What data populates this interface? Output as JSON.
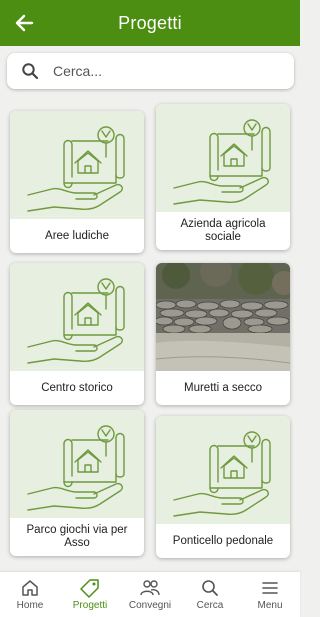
{
  "header": {
    "title": "Progetti",
    "back_icon": "arrow-left-icon"
  },
  "search": {
    "placeholder": "Cerca...",
    "value": "",
    "icon": "search-icon"
  },
  "cards": [
    {
      "label": "Aree ludiche",
      "image": "project-plan-icon"
    },
    {
      "label": "Azienda agricola sociale",
      "image": "project-plan-icon"
    },
    {
      "label": "Centro storico",
      "image": "project-plan-icon"
    },
    {
      "label": "Muretti a secco",
      "image": "stone-wall-photo"
    },
    {
      "label": "Parco giochi via per Asso",
      "image": "project-plan-icon"
    },
    {
      "label": "Ponticello pedonale",
      "image": "project-plan-icon"
    }
  ],
  "nav": {
    "items": [
      {
        "label": "Home",
        "icon": "home-icon",
        "active": false
      },
      {
        "label": "Progetti",
        "icon": "tag-icon",
        "active": true
      },
      {
        "label": "Convegni",
        "icon": "people-icon",
        "active": false
      },
      {
        "label": "Cerca",
        "icon": "search-icon",
        "active": false
      },
      {
        "label": "Menu",
        "icon": "menu-icon",
        "active": false
      }
    ]
  },
  "colors": {
    "primary": "#4b8e12",
    "card_placeholder_bg": "#e7efe0",
    "icon_stroke": "#6f9a3f"
  }
}
